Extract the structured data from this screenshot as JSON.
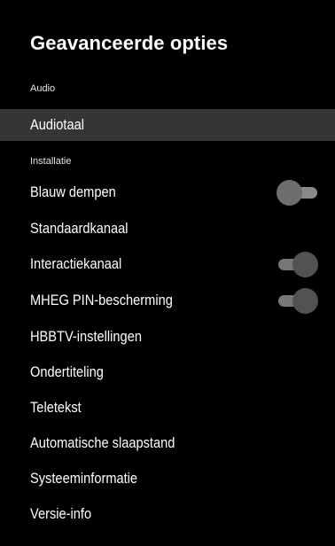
{
  "panel": {
    "title": "Geavanceerde opties"
  },
  "sections": {
    "audio": "Audio",
    "installatie": "Installatie"
  },
  "items": [
    {
      "label": "Audiotaal",
      "selected": true
    },
    {
      "label": "Blauw dempen",
      "toggle": "off"
    },
    {
      "label": "Standaardkanaal"
    },
    {
      "label": "Interactiekanaal",
      "toggle": "on"
    },
    {
      "label": "MHEG PIN-bescherming",
      "toggle": "on"
    },
    {
      "label": "HBBTV-instellingen"
    },
    {
      "label": "Ondertiteling"
    },
    {
      "label": "Teletekst"
    },
    {
      "label": "Automatische slaapstand"
    },
    {
      "label": "Systeeminformatie"
    },
    {
      "label": "Versie-info"
    }
  ],
  "colors": {
    "background": "#000000",
    "selected_row": "#353535",
    "text": "#ffffff"
  }
}
